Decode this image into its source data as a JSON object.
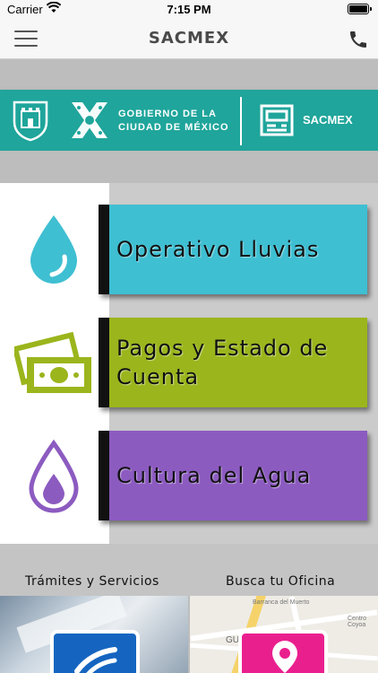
{
  "status_bar": {
    "carrier": "Carrier",
    "time": "7:15 PM"
  },
  "nav": {
    "title": "SACMEX",
    "menu_icon": "hamburger-menu-icon",
    "phone_icon": "phone-icon"
  },
  "banner": {
    "gov_line1": "GOBIERNO DE LA",
    "gov_line2": "CIUDAD DE MÉXICO",
    "org_name": "SACMEX",
    "color": "#1fa59b"
  },
  "categories": [
    {
      "label": "Operativo Lluvias",
      "icon": "water-drop-icon",
      "color": "#3fbfd2"
    },
    {
      "label": "Pagos y Estado de Cuenta",
      "icon": "money-bills-icon",
      "color": "#9bb51c"
    },
    {
      "label": "Cultura del Agua",
      "icon": "water-drop-outline-icon",
      "color": "#8c5bc0"
    }
  ],
  "bottom": {
    "tramites_label": "Trámites y Servicios",
    "oficina_label": "Busca tu Oficina",
    "tramites_badge_color": "#1565c0",
    "oficina_badge_color": "#ea1f8e",
    "map_labels": [
      "Barranca del Muerto",
      "Centro Coyoa",
      "GUAD"
    ]
  }
}
